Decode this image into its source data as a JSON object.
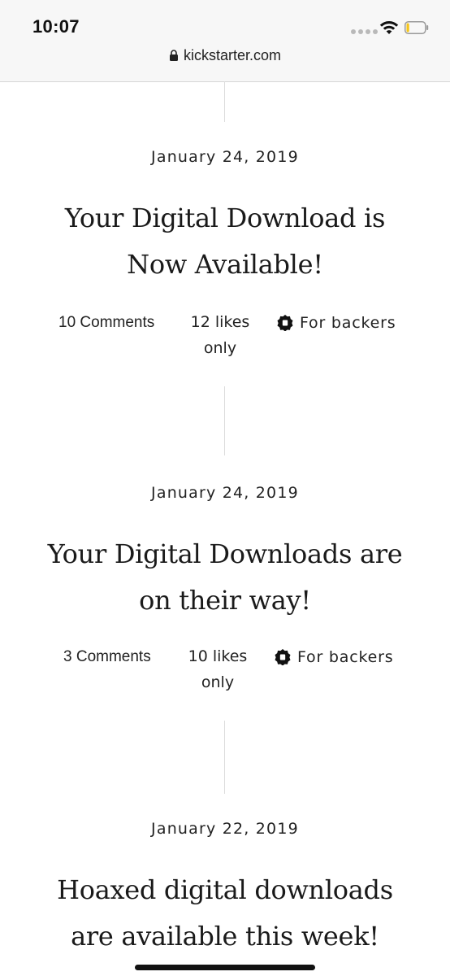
{
  "status_bar": {
    "time": "10:07",
    "url": "kickstarter.com",
    "icons": [
      "signal-icon",
      "wifi-icon",
      "battery-icon",
      "lock-icon"
    ],
    "battery_level": 0.15,
    "battery_color": "#f5c518"
  },
  "posts": [
    {
      "date": "January 24, 2019",
      "title": "Your Digital Download is Now Available!",
      "comments": "10 Comments",
      "likes_line1": "12 likes",
      "likes_line2": "only",
      "badge": "For backers"
    },
    {
      "date": "January 24, 2019",
      "title": "Your Digital Downloads are on their way!",
      "comments": "3 Comments",
      "likes_line1": "10 likes",
      "likes_line2": "only",
      "badge": "For backers"
    },
    {
      "date": "January 22, 2019",
      "title": "Hoaxed digital downloads are available this week!"
    }
  ]
}
